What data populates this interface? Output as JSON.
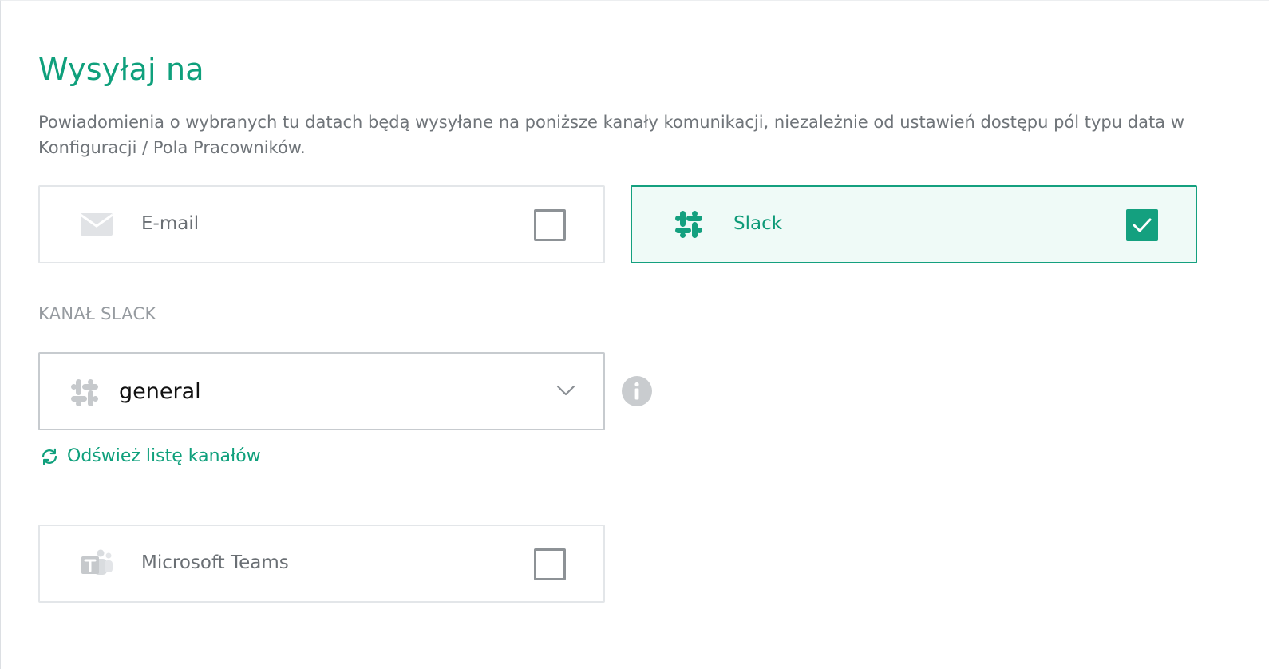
{
  "section": {
    "title": "Wysyłaj na",
    "description": "Powiadomienia o wybranych tu datach będą wysyłane na poniższe kanały komunikacji, niezależnie od ustawień dostępu pól typu data w Konfiguracji / Pola Pracowników."
  },
  "channels": {
    "email": {
      "label": "E-mail",
      "icon": "mail-icon",
      "checked": false
    },
    "slack": {
      "label": "Slack",
      "icon": "slack-icon",
      "checked": true
    },
    "teams": {
      "label": "Microsoft Teams",
      "icon": "teams-icon",
      "checked": false
    }
  },
  "slack_channel": {
    "label": "KANAŁ SLACK",
    "selected_value": "general",
    "refresh_label": "Odśwież listę kanałów"
  },
  "colors": {
    "accent": "#14a07f",
    "selected_background": "#effaf7",
    "muted_text": "#6f7479",
    "border": "#e3e6e9"
  }
}
